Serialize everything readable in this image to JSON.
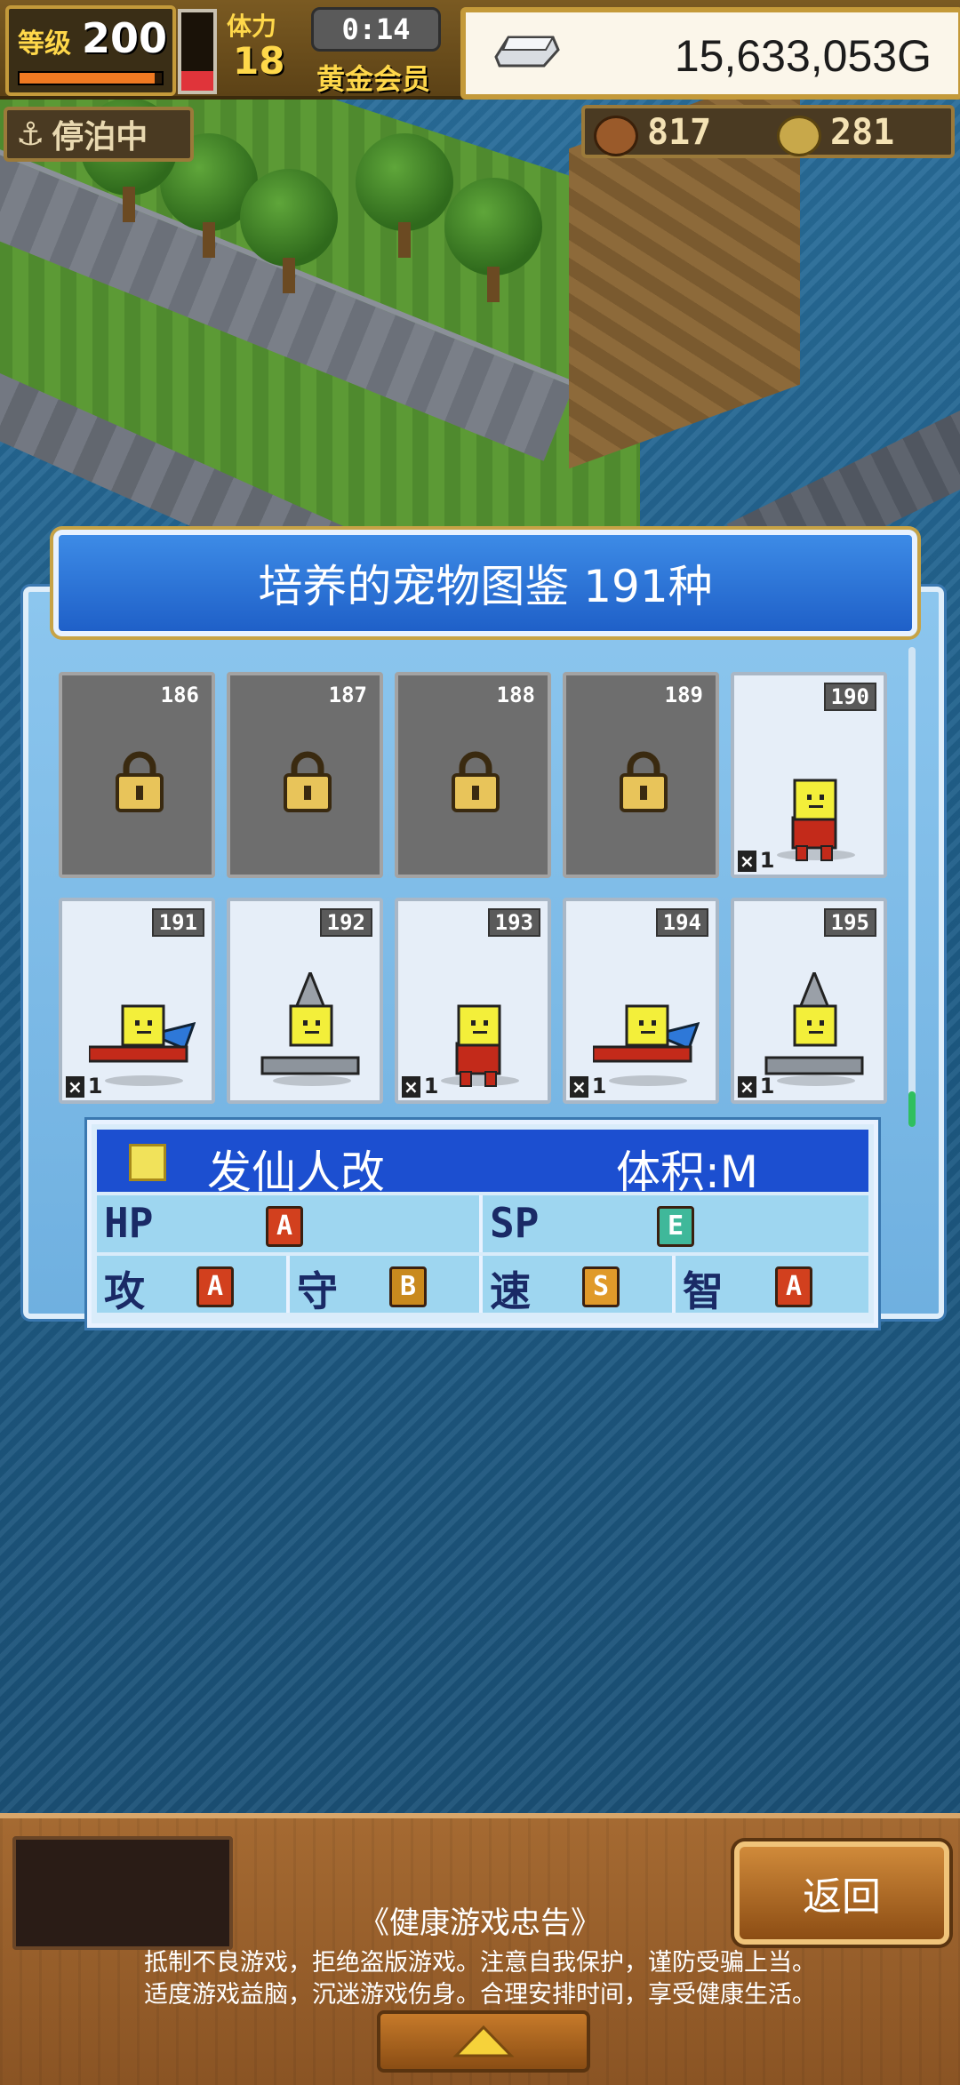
{
  "hud": {
    "level_label": "等级",
    "level_value": "200",
    "level_progress": 0.95,
    "stamina_label": "体力",
    "stamina_value": "18",
    "stamina_fill": 0.25,
    "timer": "0:14",
    "member_label": "黄金会员",
    "money": "15,633,053G",
    "money_icon": "silver-ingot-icon",
    "docked_label": "停泊中",
    "docked_icon": "anchor-icon",
    "resource_food": "817",
    "resource_food_icon": "meat-icon",
    "resource_coin": "281",
    "resource_coin_icon": "medal-icon"
  },
  "dialog": {
    "title": "培养的宠物图鉴  191种",
    "cards": [
      {
        "num": "186",
        "locked": true
      },
      {
        "num": "187",
        "locked": true
      },
      {
        "num": "188",
        "locked": true
      },
      {
        "num": "189",
        "locked": true
      },
      {
        "num": "190",
        "locked": false,
        "count": "1",
        "pet": "robot-standing"
      },
      {
        "num": "191",
        "locked": false,
        "count": "1",
        "pet": "robot-flying"
      },
      {
        "num": "192",
        "locked": false,
        "count": "",
        "pet": "robot-drill"
      },
      {
        "num": "193",
        "locked": false,
        "count": "1",
        "pet": "robot-standing"
      },
      {
        "num": "194",
        "locked": false,
        "count": "1",
        "pet": "robot-flying"
      },
      {
        "num": "195",
        "locked": false,
        "count": "1",
        "pet": "robot-drill"
      }
    ]
  },
  "info": {
    "name": "发仙人改",
    "size": "体积:M",
    "hp_label": "HP",
    "hp_grade": "A",
    "sp_label": "SP",
    "sp_grade": "E",
    "atk_label": "攻",
    "atk_grade": "A",
    "def_label": "守",
    "def_grade": "B",
    "spd_label": "速",
    "spd_grade": "S",
    "int_label": "智",
    "int_grade": "A"
  },
  "grade_colors": {
    "A": "#d2401e",
    "B": "#c98a1e",
    "S": "#e09a2a",
    "E": "#3fb89a"
  },
  "bottom": {
    "back_label": "返回",
    "notice_title": "《健康游戏忠告》",
    "notice_line1": "抵制不良游戏，拒绝盗版游戏。注意自我保护，谨防受骗上当。",
    "notice_line2": "适度游戏益脑，沉迷游戏伤身。合理安排时间，享受健康生活。",
    "expand_icon": "up-triangle-icon"
  }
}
